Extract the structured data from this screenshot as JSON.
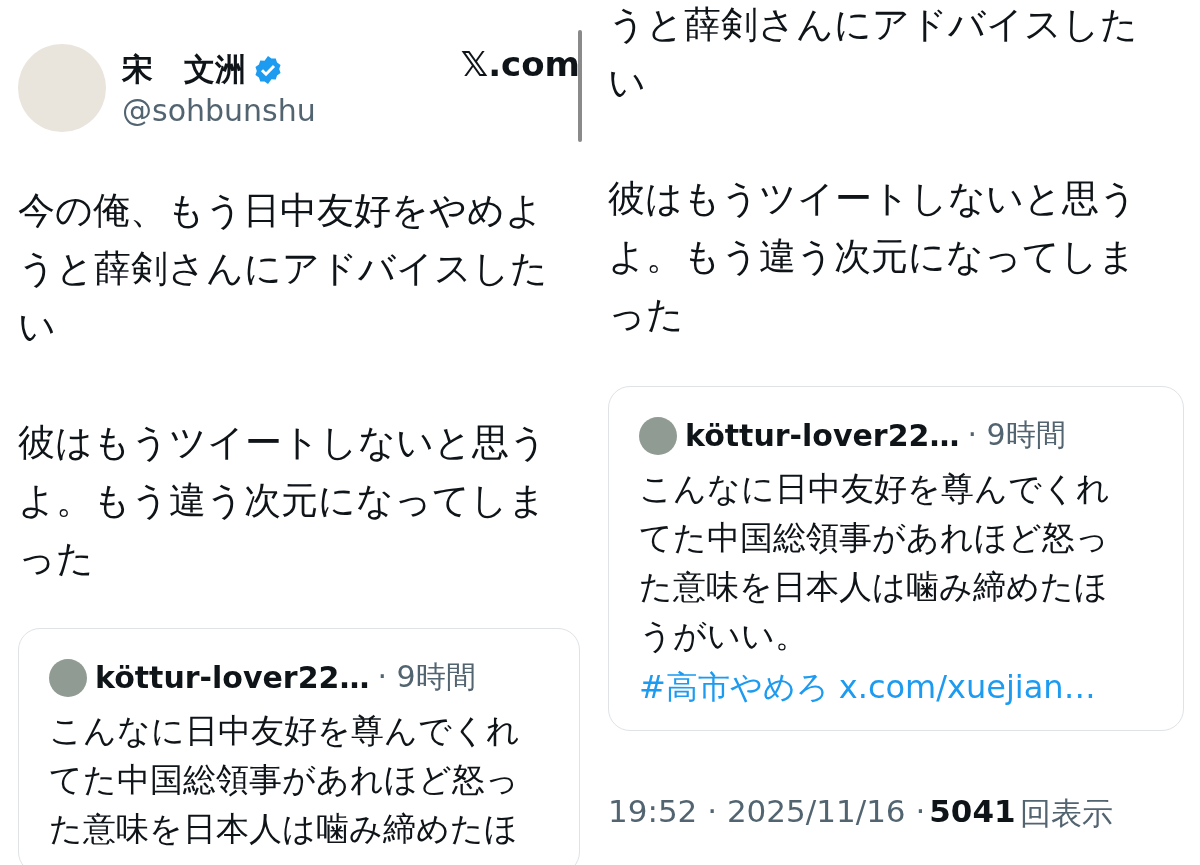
{
  "left_panel": {
    "author": {
      "name": "宋　文洲",
      "verified": true,
      "handle": "@sohbunshu"
    },
    "source": "𝕏.com",
    "paragraphs": [
      {
        "lines": [
          "今の俺、もう日中友好をやめよ",
          "うと薛剣さんにアドバイスした",
          "い"
        ]
      },
      {
        "lines": [
          "彼はもうツイートしないと思う",
          "よ。もう違う次元になってしま",
          "った"
        ]
      }
    ],
    "quote": {
      "author": "köttur-lover22…",
      "time": "· 9時間",
      "lines": [
        "こんなに日中友好を尊んでくれ",
        "てた中国総領事があれほど怒っ",
        "た意味を日本人は噛み締めたほ"
      ]
    }
  },
  "right_panel": {
    "paragraphs": [
      {
        "lines": [
          "うと薛剣さんにアドバイスした",
          "い"
        ]
      },
      {
        "lines": [
          "彼はもうツイートしないと思う",
          "よ。もう違う次元になってしま",
          "った"
        ]
      }
    ],
    "quote": {
      "author": "köttur-lover22…",
      "time": "· 9時間",
      "lines": [
        "こんなに日中友好を尊んでくれ",
        "てた中国総領事があれほど怒っ",
        "た意味を日本人は噛み締めたほ",
        "うがいい。"
      ],
      "hashtag": "#高市やめろ",
      "link": "x.com/xuejian…"
    },
    "meta": {
      "time": "19:52 · 2025/11/16 ·",
      "views_count": "5041",
      "views_label": "回表示"
    }
  }
}
